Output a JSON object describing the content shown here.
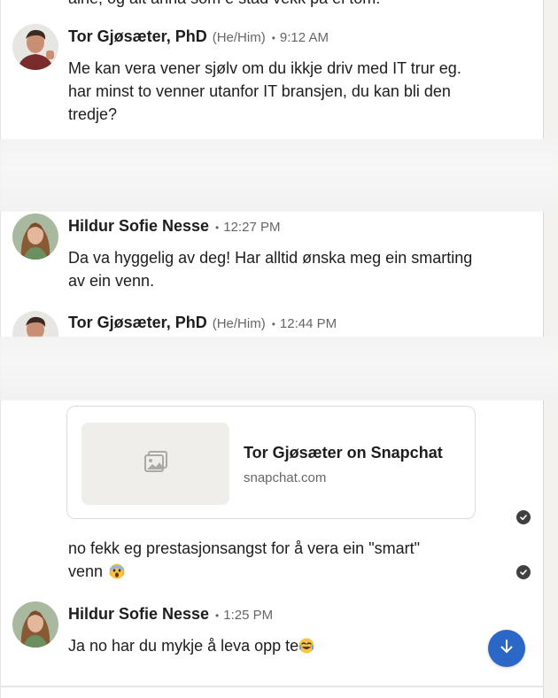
{
  "conversation": {
    "cutoff_line": "aine, og alt anna som e stad vekk på ei tom.",
    "messages": [
      {
        "sender": "Tor Gjøsæter, PhD",
        "pronouns": "(He/Him)",
        "time": "9:12 AM",
        "text": "Me kan vera vener sjølv om du ikkje driv med IT trur eg. har minst to venner utanfor IT bransjen, du kan bli den tredje?"
      },
      {
        "sender": "Hildur Sofie Nesse",
        "time": "12:27 PM",
        "text": "Da va hyggelig av deg! Har alltid ønska meg ein smarting av ein venn."
      },
      {
        "sender": "Tor Gjøsæter, PhD",
        "pronouns": "(He/Him)",
        "time": "12:44 PM"
      },
      {
        "link_card": {
          "title": "Tor Gjøsæter on Snapchat",
          "url": "snapchat.com",
          "thumbnail_icon": "image-placeholder-icon"
        }
      },
      {
        "text": "no fekk eg prestasjonsangst for å vera ein \"smart\" venn",
        "emoji": "screaming-face-emoji"
      },
      {
        "sender": "Hildur Sofie Nesse",
        "time": "1:25 PM",
        "text": "Ja no har du mykje å leva opp te",
        "emoji": "tears-of-joy-emoji"
      }
    ],
    "scroll_button_icon": "arrow-down-icon",
    "read_receipt_icon": "check-circle-icon"
  },
  "colors": {
    "accent": "#2b67c6",
    "text": "#1d1d1d",
    "muted": "#666666",
    "blur_band": "#f3f3f3"
  }
}
